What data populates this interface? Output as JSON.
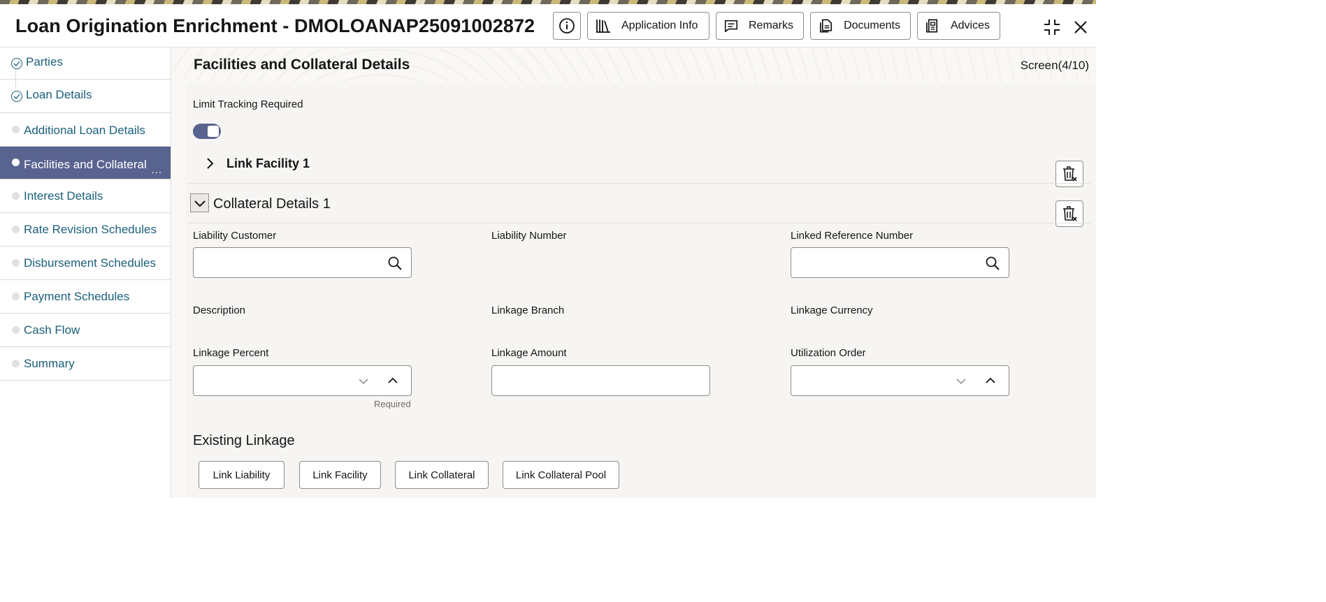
{
  "header": {
    "title": "Loan Origination Enrichment - DMOLOANAP25091002872",
    "buttons": {
      "application_info": "Application Info",
      "remarks": "Remarks",
      "documents": "Documents",
      "advices": "Advices"
    },
    "icons": [
      "info-icon",
      "library-icon",
      "comment-icon",
      "document-icon",
      "advice-icon",
      "collapse-icon",
      "close-icon"
    ]
  },
  "sidebar": {
    "items": [
      {
        "label": "Parties",
        "state": "completed"
      },
      {
        "label": "Loan Details",
        "state": "completed"
      },
      {
        "label": "Additional Loan Details",
        "state": "pending"
      },
      {
        "label": "Facilities and Collateral",
        "state": "active",
        "more": "..."
      },
      {
        "label": "Interest Details",
        "state": "pending"
      },
      {
        "label": "Rate Revision Schedules",
        "state": "pending"
      },
      {
        "label": "Disbursement Schedules",
        "state": "pending"
      },
      {
        "label": "Payment Schedules",
        "state": "pending"
      },
      {
        "label": "Cash Flow",
        "state": "pending"
      },
      {
        "label": "Summary",
        "state": "pending"
      }
    ]
  },
  "main": {
    "page_title": "Facilities and Collateral Details",
    "screen_indicator": "Screen(4/10)",
    "limit_tracking": {
      "label": "Limit Tracking Required",
      "enabled": true
    },
    "link_facility": {
      "title": "Link Facility 1",
      "expanded": false
    },
    "collateral": {
      "title": "Collateral Details 1",
      "expanded": true,
      "fields": {
        "liability_customer": {
          "label": "Liability Customer",
          "value": ""
        },
        "liability_number": {
          "label": "Liability Number"
        },
        "linked_reference_number": {
          "label": "Linked Reference Number",
          "value": ""
        },
        "description": {
          "label": "Description"
        },
        "linkage_branch": {
          "label": "Linkage Branch"
        },
        "linkage_currency": {
          "label": "Linkage Currency"
        },
        "linkage_percent": {
          "label": "Linkage Percent",
          "value": "",
          "helper": "Required"
        },
        "linkage_amount": {
          "label": "Linkage Amount",
          "value": ""
        },
        "utilization_order": {
          "label": "Utilization Order",
          "value": ""
        }
      }
    },
    "existing_linkage": {
      "title": "Existing Linkage",
      "buttons": {
        "link_liability": "Link Liability",
        "link_facility": "Link Facility",
        "link_collateral": "Link Collateral",
        "link_collateral_pool": "Link Collateral Pool"
      }
    }
  },
  "colors": {
    "accent": "#59638f",
    "link": "#1a5f7a",
    "border": "#8f8c86",
    "panel": "#f6f5f3"
  }
}
